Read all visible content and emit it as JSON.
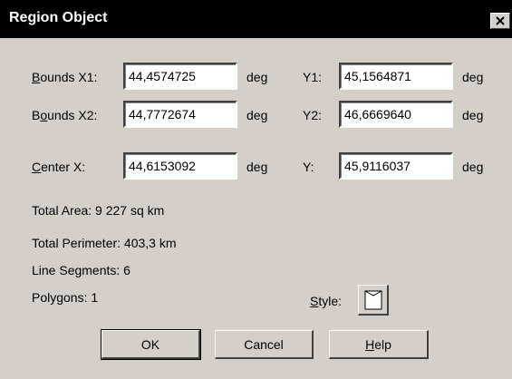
{
  "window": {
    "title": "Region Object"
  },
  "bounds": {
    "x1": {
      "label_pre": "",
      "label_accel": "B",
      "label_post": "ounds X1:",
      "value": "44,4574725",
      "unit": "deg"
    },
    "y1": {
      "label": "Y1:",
      "value": "45,1564871",
      "unit": "deg"
    },
    "x2": {
      "label_pre": "B",
      "label_accel": "o",
      "label_post": "unds X2:",
      "value": "44,7772674",
      "unit": "deg"
    },
    "y2": {
      "label": "Y2:",
      "value": "46,6669640",
      "unit": "deg"
    }
  },
  "center": {
    "x": {
      "label_pre": "",
      "label_accel": "C",
      "label_post": "enter X:",
      "value": "44,6153092",
      "unit": "deg"
    },
    "y": {
      "label": "Y:",
      "value": "45,9116037",
      "unit": "deg"
    }
  },
  "info": {
    "total_area": "Total Area:  9 227 sq km",
    "total_perimeter": "Total Perimeter:  403,3 km",
    "line_segments": "Line Segments:  6",
    "polygons": "Polygons:  1"
  },
  "style": {
    "label_pre": "",
    "label_accel": "S",
    "label_post": "tyle:"
  },
  "buttons": {
    "ok": "OK",
    "cancel": "Cancel",
    "help_pre": "",
    "help_accel": "H",
    "help_post": "elp"
  },
  "icons": {
    "close": "close-icon",
    "style": "region-style-icon"
  }
}
